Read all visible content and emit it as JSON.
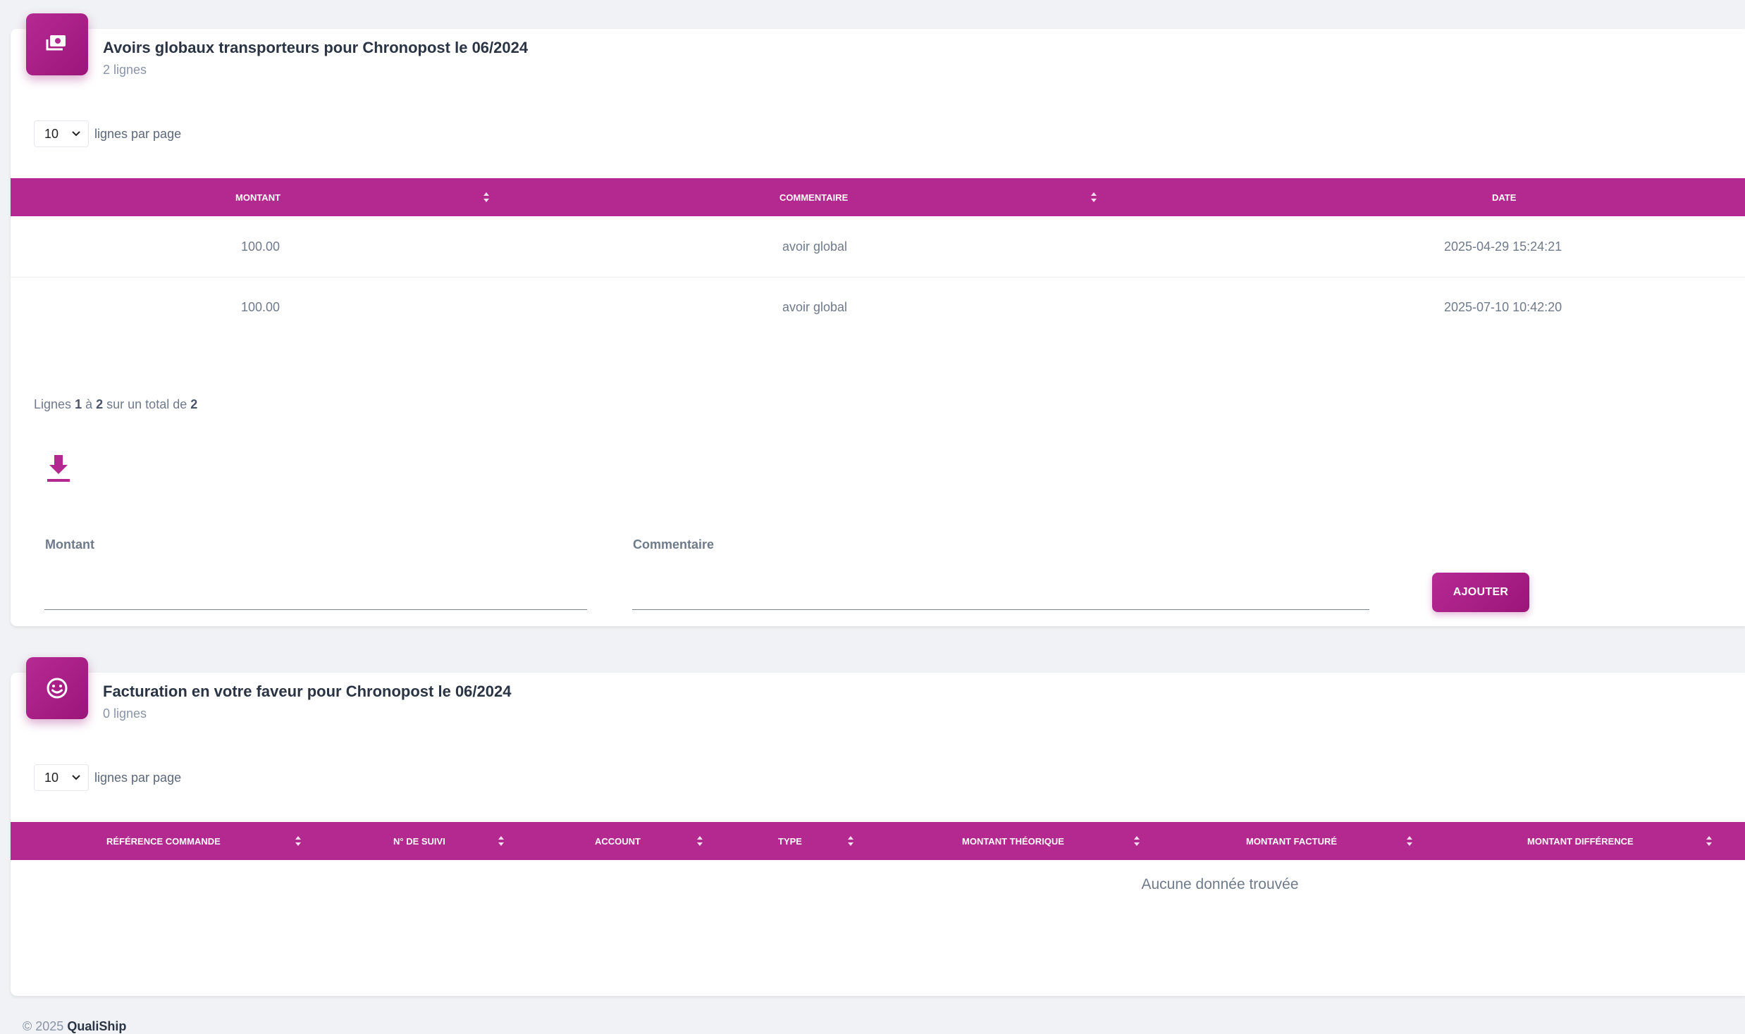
{
  "avoirs": {
    "title": "Avoirs globaux transporteurs pour Chronopost le 06/2024",
    "subtitle": "2 lignes",
    "per_page_value": "10",
    "per_page_label": "lignes par page",
    "columns": [
      "MONTANT",
      "COMMENTAIRE",
      "DATE"
    ],
    "rows": [
      {
        "montant": "100.00",
        "commentaire": "avoir global",
        "date": "2025-04-29 15:24:21"
      },
      {
        "montant": "100.00",
        "commentaire": "avoir global",
        "date": "2025-07-10 10:42:20"
      }
    ],
    "pager": {
      "prefix": "Lignes",
      "from": "1",
      "to_word": "à",
      "to": "2",
      "total_word": "sur un total de",
      "total": "2"
    },
    "form": {
      "montant_label": "Montant",
      "commentaire_label": "Commentaire",
      "submit_label": "AJOUTER"
    }
  },
  "facturation": {
    "title": "Facturation en votre faveur pour Chronopost le 06/2024",
    "subtitle": "0 lignes",
    "per_page_value": "10",
    "per_page_label": "lignes par page",
    "columns": [
      "RÉFÉRENCE COMMANDE",
      "N° DE SUIVI",
      "ACCOUNT",
      "TYPE",
      "MONTANT THÉORIQUE",
      "MONTANT FACTURÉ",
      "MONTANT DIFFÉRENCE"
    ],
    "empty_text": "Aucune donnée trouvée"
  },
  "footer": {
    "copyright": "© 2025",
    "brand": "QualiShip"
  },
  "colors": {
    "accent": "#b3298f",
    "accent_dark": "#9c1579",
    "background": "#f0f2f5"
  }
}
